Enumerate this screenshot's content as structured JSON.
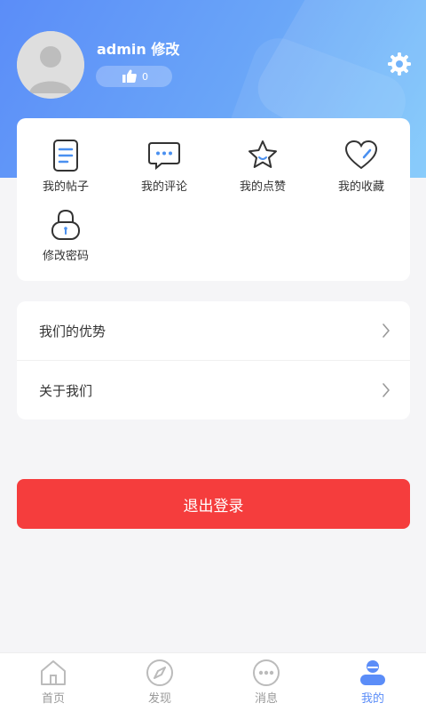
{
  "profile": {
    "username": "admin",
    "edit_label": "修改",
    "likes_count": "0"
  },
  "quick_actions": [
    {
      "label": "我的帖子",
      "icon": "document-icon"
    },
    {
      "label": "我的评论",
      "icon": "comment-icon"
    },
    {
      "label": "我的点赞",
      "icon": "star-icon"
    },
    {
      "label": "我的收藏",
      "icon": "heart-icon"
    },
    {
      "label": "修改密码",
      "icon": "lock-icon"
    }
  ],
  "menu": [
    {
      "label": "我们的优势"
    },
    {
      "label": "关于我们"
    }
  ],
  "logout_label": "退出登录",
  "tabs": [
    {
      "label": "首页",
      "icon": "home-icon"
    },
    {
      "label": "发现",
      "icon": "compass-icon"
    },
    {
      "label": "消息",
      "icon": "message-icon"
    },
    {
      "label": "我的",
      "icon": "profile-icon",
      "active": true
    }
  ],
  "colors": {
    "accent": "#5b8df8",
    "danger": "#f53d3d",
    "background": "#f5f5f7"
  }
}
